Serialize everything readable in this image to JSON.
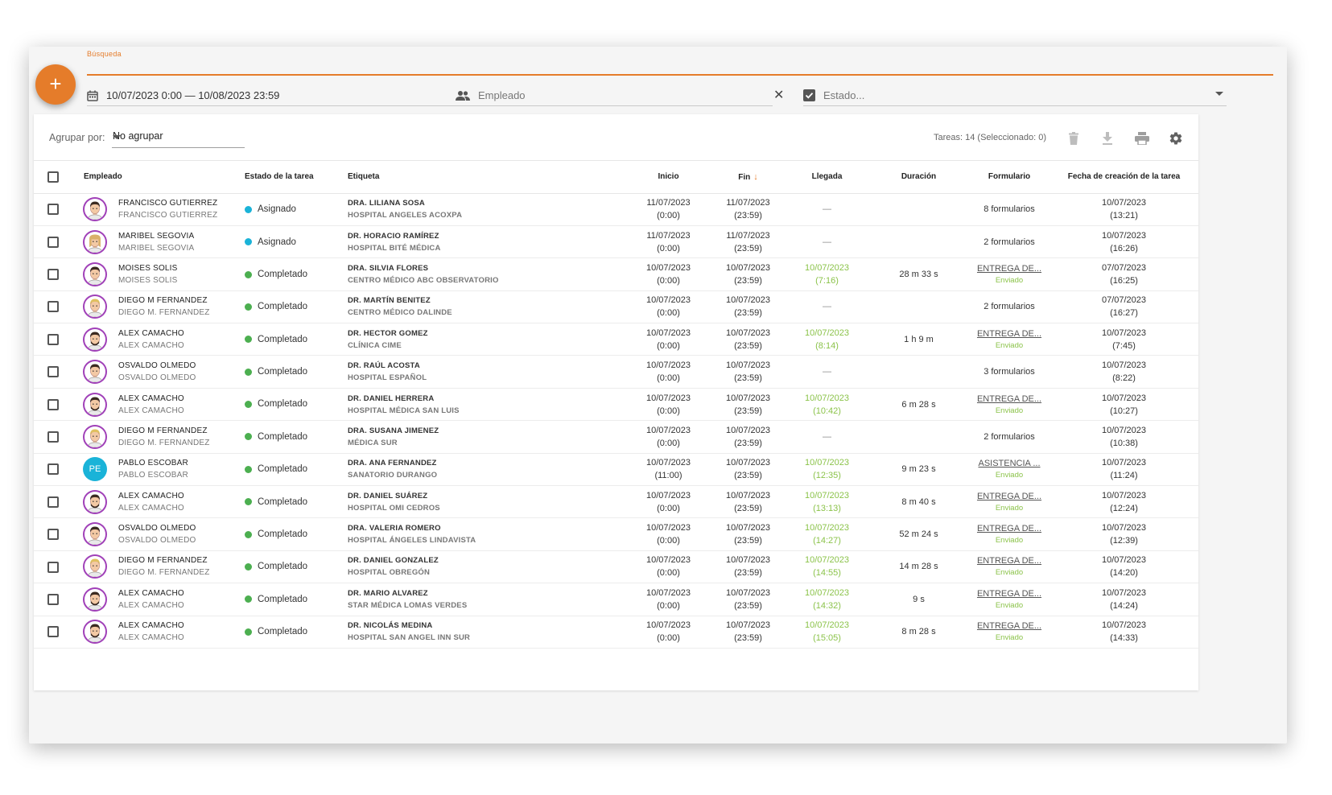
{
  "search": {
    "label": "Búsqueda"
  },
  "fab": {
    "label": "+"
  },
  "filters": {
    "date_range": "10/07/2023 0:00 — 10/08/2023 23:59",
    "employee_placeholder": "Empleado",
    "state_placeholder": "Estado..."
  },
  "toolbar": {
    "group_label": "Agrupar por:",
    "group_value": "No agrupar",
    "count_text": "Tareas: 14 (Seleccionado: 0)"
  },
  "columns": {
    "employee": "Empleado",
    "state": "Estado de la tarea",
    "tag": "Etiqueta",
    "start": "Inicio",
    "end": "Fin",
    "arrival": "Llegada",
    "duration": "Duración",
    "form": "Formulario",
    "created": "Fecha de creación de la tarea"
  },
  "colors": {
    "accent": "#e57c2a",
    "assigned": "#1ab3d8",
    "completed": "#4caf50",
    "arrival": "#8bc34a"
  },
  "rows": [
    {
      "avatar": "man-icon",
      "name": "FRANCISCO GUTIERREZ",
      "sub": "FRANCISCO GUTIERREZ",
      "state": "Asignado",
      "state_color": "#1ab3d8",
      "tag": "DRA. LILIANA SOSA",
      "tag_sub": "HOSPITAL ANGELES ACOXPA",
      "start_date": "11/07/2023",
      "start_time": "(0:00)",
      "end_date": "11/07/2023",
      "end_time": "(23:59)",
      "arrival_date": "—",
      "arrival_time": "",
      "duration": "",
      "form": "8 formularios",
      "form_status": "",
      "created_date": "10/07/2023",
      "created_time": "(13:21)"
    },
    {
      "avatar": "woman-icon",
      "name": "MARIBEL SEGOVIA",
      "sub": "MARIBEL SEGOVIA",
      "state": "Asignado",
      "state_color": "#1ab3d8",
      "tag": "DR. HORACIO RAMÍREZ",
      "tag_sub": "HOSPITAL BITÉ MÉDICA",
      "start_date": "11/07/2023",
      "start_time": "(0:00)",
      "end_date": "11/07/2023",
      "end_time": "(23:59)",
      "arrival_date": "—",
      "arrival_time": "",
      "duration": "",
      "form": "2 formularios",
      "form_status": "",
      "created_date": "10/07/2023",
      "created_time": "(16:26)"
    },
    {
      "avatar": "man-icon",
      "name": "MOISES SOLIS",
      "sub": "MOISES SOLIS",
      "state": "Completado",
      "state_color": "#4caf50",
      "tag": "DRA. SILVIA FLORES",
      "tag_sub": "CENTRO MÉDICO ABC OBSERVATORIO",
      "start_date": "10/07/2023",
      "start_time": "(0:00)",
      "end_date": "10/07/2023",
      "end_time": "(23:59)",
      "arrival_date": "10/07/2023",
      "arrival_time": "(7:16)",
      "duration": "28 m 33 s",
      "form": "ENTREGA DE...",
      "form_status": "Enviado",
      "created_date": "07/07/2023",
      "created_time": "(16:25)"
    },
    {
      "avatar": "blond-man-icon",
      "name": "DIEGO M FERNANDEZ",
      "sub": "DIEGO M. FERNANDEZ",
      "state": "Completado",
      "state_color": "#4caf50",
      "tag": "DR. MARTÍN BENITEZ",
      "tag_sub": "CENTRO MÉDICO DALINDE",
      "start_date": "10/07/2023",
      "start_time": "(0:00)",
      "end_date": "10/07/2023",
      "end_time": "(23:59)",
      "arrival_date": "—",
      "arrival_time": "",
      "duration": "",
      "form": "2 formularios",
      "form_status": "",
      "created_date": "07/07/2023",
      "created_time": "(16:27)"
    },
    {
      "avatar": "bearded-man-icon",
      "name": "ALEX CAMACHO",
      "sub": "ALEX CAMACHO",
      "state": "Completado",
      "state_color": "#4caf50",
      "tag": "DR. HECTOR GOMEZ",
      "tag_sub": "CLÍNICA CIME",
      "start_date": "10/07/2023",
      "start_time": "(0:00)",
      "end_date": "10/07/2023",
      "end_time": "(23:59)",
      "arrival_date": "10/07/2023",
      "arrival_time": "(8:14)",
      "duration": "1 h 9 m",
      "form": "ENTREGA DE...",
      "form_status": "Enviado",
      "created_date": "10/07/2023",
      "created_time": "(7:45)"
    },
    {
      "avatar": "man-icon",
      "name": "OSVALDO OLMEDO",
      "sub": "OSVALDO OLMEDO",
      "state": "Completado",
      "state_color": "#4caf50",
      "tag": "DR. RAÚL ACOSTA",
      "tag_sub": "HOSPITAL ESPAÑOL",
      "start_date": "10/07/2023",
      "start_time": "(0:00)",
      "end_date": "10/07/2023",
      "end_time": "(23:59)",
      "arrival_date": "—",
      "arrival_time": "",
      "duration": "",
      "form": "3 formularios",
      "form_status": "",
      "created_date": "10/07/2023",
      "created_time": "(8:22)"
    },
    {
      "avatar": "bearded-man-icon",
      "name": "ALEX CAMACHO",
      "sub": "ALEX CAMACHO",
      "state": "Completado",
      "state_color": "#4caf50",
      "tag": "DR. DANIEL HERRERA",
      "tag_sub": "HOSPITAL MÉDICA SAN LUIS",
      "start_date": "10/07/2023",
      "start_time": "(0:00)",
      "end_date": "10/07/2023",
      "end_time": "(23:59)",
      "arrival_date": "10/07/2023",
      "arrival_time": "(10:42)",
      "duration": "6 m 28 s",
      "form": "ENTREGA DE...",
      "form_status": "Enviado",
      "created_date": "10/07/2023",
      "created_time": "(10:27)"
    },
    {
      "avatar": "blond-man-icon",
      "name": "DIEGO M FERNANDEZ",
      "sub": "DIEGO M. FERNANDEZ",
      "state": "Completado",
      "state_color": "#4caf50",
      "tag": "DRA. SUSANA JIMENEZ",
      "tag_sub": "MÉDICA SUR",
      "start_date": "10/07/2023",
      "start_time": "(0:00)",
      "end_date": "10/07/2023",
      "end_time": "(23:59)",
      "arrival_date": "—",
      "arrival_time": "",
      "duration": "",
      "form": "2 formularios",
      "form_status": "",
      "created_date": "10/07/2023",
      "created_time": "(10:38)"
    },
    {
      "avatar": "initials",
      "initials": "PE",
      "name": "PABLO ESCOBAR",
      "sub": "PABLO ESCOBAR",
      "state": "Completado",
      "state_color": "#4caf50",
      "tag": "DRA. ANA FERNANDEZ",
      "tag_sub": "SANATORIO DURANGO",
      "start_date": "10/07/2023",
      "start_time": "(11:00)",
      "end_date": "10/07/2023",
      "end_time": "(23:59)",
      "arrival_date": "10/07/2023",
      "arrival_time": "(12:35)",
      "duration": "9 m 23 s",
      "form": "ASISTENCIA ...",
      "form_status": "Enviado",
      "created_date": "10/07/2023",
      "created_time": "(11:24)"
    },
    {
      "avatar": "bearded-man-icon",
      "name": "ALEX CAMACHO",
      "sub": "ALEX CAMACHO",
      "state": "Completado",
      "state_color": "#4caf50",
      "tag": "DR. DANIEL SUÁREZ",
      "tag_sub": "HOSPITAL OMI CEDROS",
      "start_date": "10/07/2023",
      "start_time": "(0:00)",
      "end_date": "10/07/2023",
      "end_time": "(23:59)",
      "arrival_date": "10/07/2023",
      "arrival_time": "(13:13)",
      "duration": "8 m 40 s",
      "form": "ENTREGA DE...",
      "form_status": "Enviado",
      "created_date": "10/07/2023",
      "created_time": "(12:24)"
    },
    {
      "avatar": "man-icon",
      "name": "OSVALDO OLMEDO",
      "sub": "OSVALDO OLMEDO",
      "state": "Completado",
      "state_color": "#4caf50",
      "tag": "DRA. VALERIA ROMERO",
      "tag_sub": "HOSPITAL ÁNGELES LINDAVISTA",
      "start_date": "10/07/2023",
      "start_time": "(0:00)",
      "end_date": "10/07/2023",
      "end_time": "(23:59)",
      "arrival_date": "10/07/2023",
      "arrival_time": "(14:27)",
      "duration": "52 m 24 s",
      "form": "ENTREGA DE...",
      "form_status": "Enviado",
      "created_date": "10/07/2023",
      "created_time": "(12:39)"
    },
    {
      "avatar": "blond-man-icon",
      "name": "DIEGO M FERNANDEZ",
      "sub": "DIEGO M. FERNANDEZ",
      "state": "Completado",
      "state_color": "#4caf50",
      "tag": "DR. DANIEL GONZALEZ",
      "tag_sub": "HOSPITAL OBREGÓN",
      "start_date": "10/07/2023",
      "start_time": "(0:00)",
      "end_date": "10/07/2023",
      "end_time": "(23:59)",
      "arrival_date": "10/07/2023",
      "arrival_time": "(14:55)",
      "duration": "14 m 28 s",
      "form": "ENTREGA DE...",
      "form_status": "Enviado",
      "created_date": "10/07/2023",
      "created_time": "(14:20)"
    },
    {
      "avatar": "bearded-man-icon",
      "name": "ALEX CAMACHO",
      "sub": "ALEX CAMACHO",
      "state": "Completado",
      "state_color": "#4caf50",
      "tag": "DR. MARIO ALVAREZ",
      "tag_sub": "STAR MÉDICA LOMAS VERDES",
      "start_date": "10/07/2023",
      "start_time": "(0:00)",
      "end_date": "10/07/2023",
      "end_time": "(23:59)",
      "arrival_date": "10/07/2023",
      "arrival_time": "(14:32)",
      "duration": "9 s",
      "form": "ENTREGA DE...",
      "form_status": "Enviado",
      "created_date": "10/07/2023",
      "created_time": "(14:24)"
    },
    {
      "avatar": "bearded-man-icon",
      "name": "ALEX CAMACHO",
      "sub": "ALEX CAMACHO",
      "state": "Completado",
      "state_color": "#4caf50",
      "tag": "DR. NICOLÁS MEDINA",
      "tag_sub": "HOSPITAL SAN ANGEL INN SUR",
      "start_date": "10/07/2023",
      "start_time": "(0:00)",
      "end_date": "10/07/2023",
      "end_time": "(23:59)",
      "arrival_date": "10/07/2023",
      "arrival_time": "(15:05)",
      "duration": "8 m 28 s",
      "form": "ENTREGA DE...",
      "form_status": "Enviado",
      "created_date": "10/07/2023",
      "created_time": "(14:33)"
    }
  ]
}
